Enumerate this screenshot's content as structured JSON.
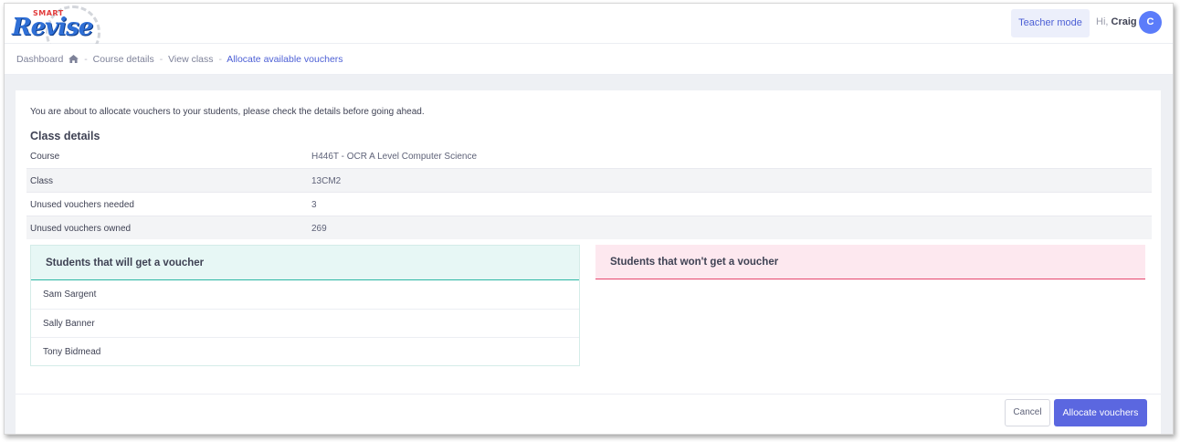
{
  "header": {
    "logo_small_text": "SMART",
    "logo_text": "Revise",
    "teacher_mode_label": "Teacher mode",
    "greeting_prefix": "Hi,",
    "user_name": "Craig",
    "avatar_initial": "C"
  },
  "breadcrumb": {
    "items": [
      "Dashboard",
      "Course details",
      "View class",
      "Allocate available vouchers"
    ],
    "home_icon": "home-icon",
    "separator": "-"
  },
  "main": {
    "intro": "You are about to allocate vouchers to your students, please check the details before going ahead.",
    "section_title": "Class details",
    "details": [
      {
        "label": "Course",
        "value": "H446T - OCR A Level Computer Science"
      },
      {
        "label": "Class",
        "value": "13CM2"
      },
      {
        "label": "Unused vouchers needed",
        "value": "3"
      },
      {
        "label": "Unused vouchers owned",
        "value": "269"
      }
    ],
    "students_get": {
      "title": "Students that will get a voucher",
      "students": [
        "Sam Sargent",
        "Sally Banner",
        "Tony Bidmead"
      ]
    },
    "students_not": {
      "title": "Students that won't get a voucher",
      "students": []
    }
  },
  "footer": {
    "cancel_label": "Cancel",
    "allocate_label": "Allocate vouchers"
  },
  "colors": {
    "accent": "#4c5fd5",
    "primary_button": "#5b67e0",
    "success_border": "#2cb7a3",
    "danger_border": "#e6456c"
  }
}
